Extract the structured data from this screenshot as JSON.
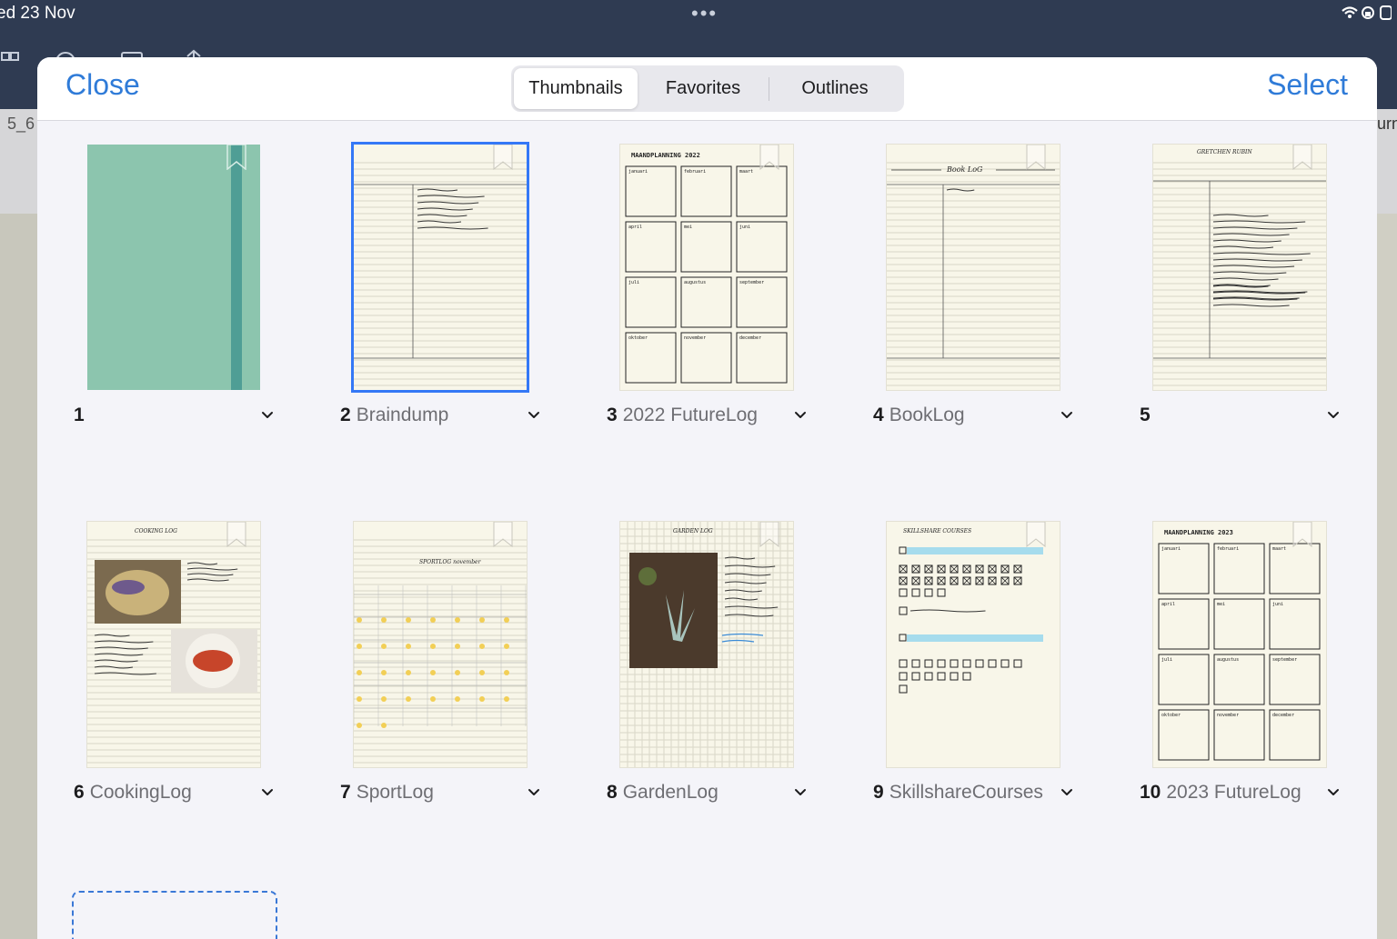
{
  "status_bar": {
    "date": "ed 23 Nov",
    "dots": "•••",
    "system_icons": "wifi lock battery"
  },
  "background": {
    "left_tab_text": "5_6",
    "right_tab_text": "urn"
  },
  "header": {
    "close_label": "Close",
    "select_label": "Select",
    "tabs": [
      {
        "label": "Thumbnails",
        "active": true
      },
      {
        "label": "Favorites",
        "active": false
      },
      {
        "label": "Outlines",
        "active": false
      }
    ]
  },
  "pages": [
    {
      "number": "1",
      "title": "",
      "kind": "cover",
      "color": "#8cc5ae"
    },
    {
      "number": "2",
      "title": "Braindump",
      "kind": "list",
      "selected": true
    },
    {
      "number": "3",
      "title": "2022 FutureLog",
      "kind": "months",
      "heading": "MAANDPLANNING 2022"
    },
    {
      "number": "4",
      "title": "BookLog",
      "kind": "booklog",
      "heading": "Book LoG"
    },
    {
      "number": "5",
      "title": "",
      "kind": "notes",
      "heading": "GRETCHEN RUBIN"
    },
    {
      "number": "6",
      "title": "CookingLog",
      "kind": "cooking",
      "heading": "COOKING LOG"
    },
    {
      "number": "7",
      "title": "SportLog",
      "kind": "calendar",
      "heading": "SPORTLOG november"
    },
    {
      "number": "8",
      "title": "GardenLog",
      "kind": "garden",
      "heading": "GARDEN LOG"
    },
    {
      "number": "9",
      "title": "SkillshareCourses",
      "kind": "checkboxes",
      "heading": "SKILLSHARE COURSES"
    },
    {
      "number": "10",
      "title": "2023 FutureLog",
      "kind": "months",
      "heading": "MAANDPLANNING 2023"
    }
  ],
  "month_labels": [
    "januari",
    "februari",
    "maart",
    "april",
    "mei",
    "juni",
    "juli",
    "augustus",
    "september",
    "oktober",
    "november",
    "december"
  ],
  "colors": {
    "accent": "#2f7bd8",
    "selection": "#3478f6",
    "cover": "#8cc5ae",
    "cover_strap": "#4f9e95",
    "paper": "#f8f6e9"
  }
}
